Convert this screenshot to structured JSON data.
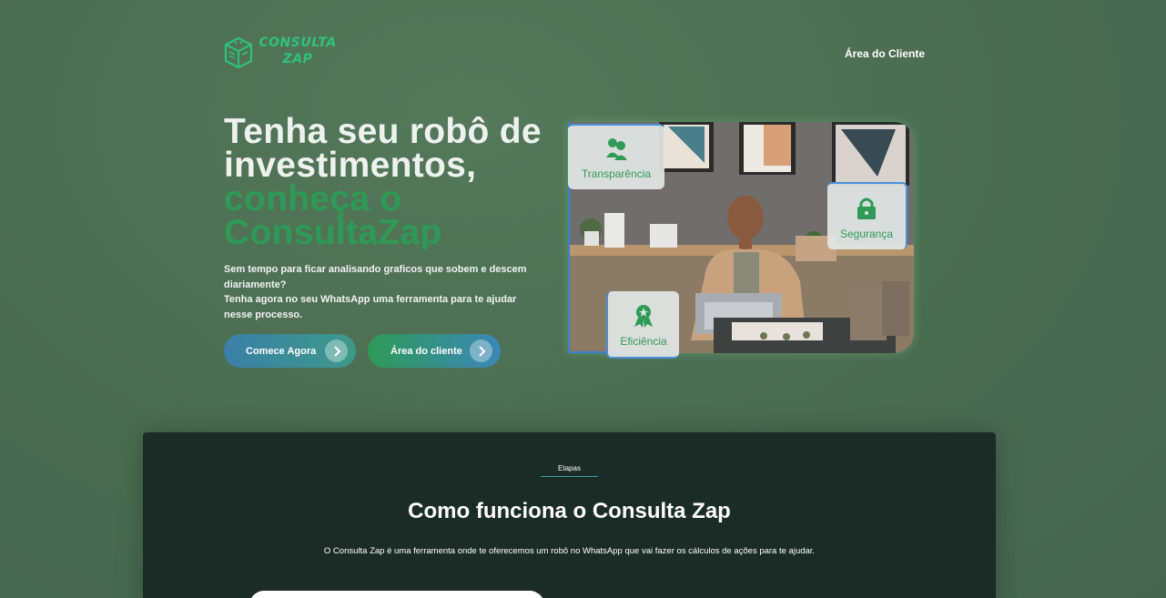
{
  "header": {
    "logo_text_line1": "CONSULTA",
    "logo_text_line2": "ZAP",
    "nav_client": "Área do Cliente"
  },
  "hero": {
    "title_line1": "Tenha seu robô de",
    "title_line2": "investimentos,",
    "title_line3": "conheça o",
    "title_line4": "ConsultaZap",
    "desc_line1": "Sem tempo para ficar analisando graficos que sobem e descem diariamente?",
    "desc_line2": "Tenha agora no seu WhatsApp uma ferramenta para te ajudar nesse processo.",
    "cta_start": "Comece Agora",
    "cta_area": "Área do cliente"
  },
  "badges": {
    "transparency": "Transparência",
    "security": "Segurança",
    "efficiency": "Eficiência"
  },
  "steps": {
    "tag": "Etapas",
    "title": "Como funciona o Consulta Zap",
    "description": "O Consulta Zap é uma ferramenta onde te oferecemos um robô no WhatsApp que vai fazer os cálculos de ações para te ajudar."
  },
  "colors": {
    "brand_green": "#2e9a56",
    "accent_blue": "#3b87b8",
    "section_dark": "#1a2c25"
  }
}
